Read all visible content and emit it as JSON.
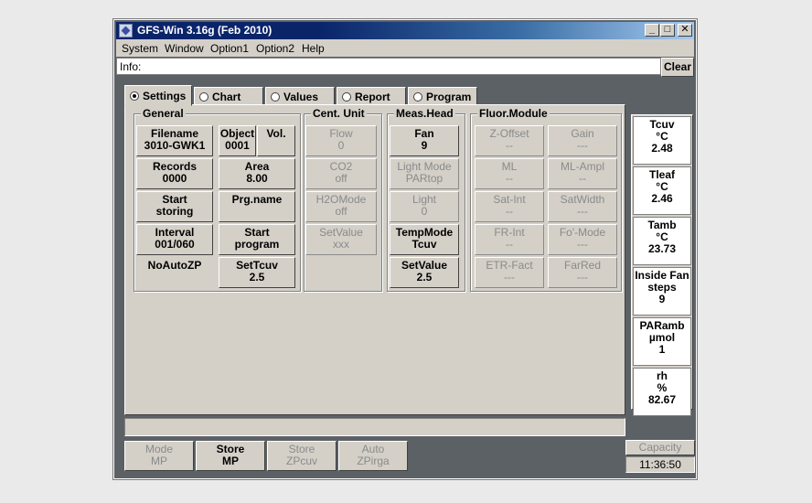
{
  "window": {
    "title": "GFS-Win 3.16g (Feb 2010)"
  },
  "titlebar_buttons": {
    "minimize": "_",
    "maximize": "□",
    "close": "✕"
  },
  "menu": [
    "System",
    "Window",
    "Option1",
    "Option2",
    "Help"
  ],
  "info": {
    "label": "Info:",
    "value": "",
    "clear_label": "Clear"
  },
  "tabs": [
    {
      "label": "Settings",
      "selected": true
    },
    {
      "label": "Chart",
      "selected": false
    },
    {
      "label": "Values",
      "selected": false
    },
    {
      "label": "Report",
      "selected": false
    },
    {
      "label": "Program",
      "selected": false
    }
  ],
  "general": {
    "title": "General",
    "filename": {
      "label": "Filename",
      "value": "3010-GWK1"
    },
    "object": {
      "label": "Object",
      "value": "0001"
    },
    "vol": {
      "label": "Vol.",
      "value": ""
    },
    "records": {
      "label": "Records",
      "value": "0000"
    },
    "area": {
      "label": "Area",
      "value": "8.00"
    },
    "start_storing": {
      "line1": "Start",
      "line2": "storing"
    },
    "prg_name": {
      "label": "Prg.name",
      "value": ""
    },
    "interval": {
      "label": "Interval",
      "value": "001/060"
    },
    "start_program": {
      "line1": "Start",
      "line2": "program"
    },
    "noautozp": {
      "label": "NoAutoZP"
    },
    "settcuv": {
      "label": "SetTcuv",
      "value": "2.5"
    }
  },
  "cent_unit": {
    "title": "Cent. Unit",
    "flow": {
      "label": "Flow",
      "value": "0"
    },
    "co2": {
      "label": "CO2",
      "value": "off"
    },
    "h2omode": {
      "label": "H2OMode",
      "value": "off"
    },
    "setvalue": {
      "label": "SetValue",
      "value": "xxx"
    }
  },
  "meas_head": {
    "title": "Meas.Head",
    "fan": {
      "label": "Fan",
      "value": "9"
    },
    "lightmode": {
      "label": "Light Mode",
      "value": "PARtop"
    },
    "light": {
      "label": "Light",
      "value": "0"
    },
    "tempmode": {
      "label": "TempMode",
      "value": "Tcuv"
    },
    "setvalue": {
      "label": "SetValue",
      "value": "2.5"
    }
  },
  "fluor_module": {
    "title": "Fluor.Module",
    "zoffset": {
      "label": "Z-Offset",
      "value": "--"
    },
    "gain": {
      "label": "Gain",
      "value": "---"
    },
    "ml": {
      "label": "ML",
      "value": "--"
    },
    "mlampl": {
      "label": "ML-Ampl",
      "value": "--"
    },
    "satint": {
      "label": "Sat-Int",
      "value": "--"
    },
    "satwidth": {
      "label": "SatWidth",
      "value": "---"
    },
    "frint": {
      "label": "FR-Int",
      "value": "--"
    },
    "fomode": {
      "label": "Fo'-Mode",
      "value": "---"
    },
    "etrfact": {
      "label": "ETR-Fact",
      "value": "---"
    },
    "farred": {
      "label": "FarRed",
      "value": "---"
    }
  },
  "readouts": [
    {
      "name": "Tcuv",
      "unit": "°C",
      "value": "2.48"
    },
    {
      "name": "Tleaf",
      "unit": "°C",
      "value": "2.46"
    },
    {
      "name": "Tamb",
      "unit": "°C",
      "value": "23.73"
    },
    {
      "name": "Inside Fan",
      "unit": "steps",
      "value": "9"
    },
    {
      "name": "PARamb",
      "unit": "µmol",
      "value": "1"
    },
    {
      "name": "rh",
      "unit": "%",
      "value": "82.67"
    }
  ],
  "bottom_buttons": [
    {
      "line1": "Mode",
      "line2": "MP",
      "enabled": false
    },
    {
      "line1": "Store",
      "line2": "MP",
      "enabled": true
    },
    {
      "line1": "Store",
      "line2": "ZPcuv",
      "enabled": false
    },
    {
      "line1": "Auto",
      "line2": "ZPirga",
      "enabled": false
    }
  ],
  "status": {
    "capacity_label": "Capacity",
    "clock": "11:36:50"
  }
}
